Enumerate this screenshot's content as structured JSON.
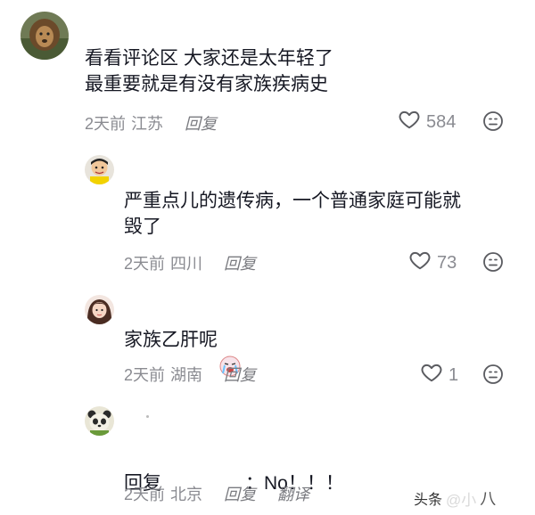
{
  "comments": [
    {
      "text": "看看评论区 大家还是太年轻了\n最重要就是有没有家族疾病史",
      "time": "2天前",
      "location": "江苏",
      "reply_label": "回复",
      "likes": "584",
      "avatar": "lion-avatar"
    },
    {
      "text": "严重点儿的遗传病，一个普通家庭可能就\n毁了",
      "time": "2天前",
      "location": "四川",
      "reply_label": "回复",
      "likes": "73",
      "avatar": "cartoon-man-avatar"
    },
    {
      "text": "家族乙肝呢",
      "emoji": "crying-face-emoji",
      "time": "2天前",
      "location": "湖南",
      "reply_label": "回复",
      "likes": "1",
      "avatar": "girl-avatar"
    },
    {
      "text_prefix": "回复",
      "text_suffix": "：No！！！",
      "time": "2天前",
      "location": "北京",
      "reply_label": "回复",
      "translate_label": "翻译",
      "avatar": "panda-avatar"
    }
  ],
  "watermark": {
    "text1": "头条",
    "text2": "@小",
    "text3": "八"
  },
  "colors": {
    "text": "#161823",
    "meta": "#8a8b91"
  }
}
